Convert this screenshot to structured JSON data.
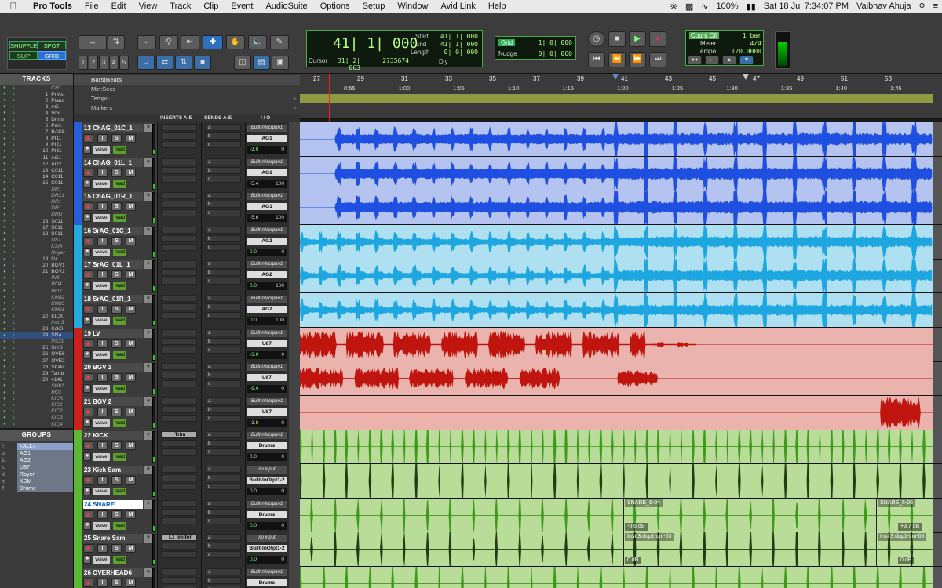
{
  "menubar": {
    "app": "Pro Tools",
    "items": [
      "File",
      "Edit",
      "View",
      "Track",
      "Clip",
      "Event",
      "AudioSuite",
      "Options",
      "Setup",
      "Window",
      "Avid Link",
      "Help"
    ],
    "battery": "100%",
    "datetime": "Sat 18 Jul  7:34:07 PM",
    "user": "Vaibhav Ahuja"
  },
  "modes": {
    "shuffle": "SHUFFLE",
    "spot": "SPOT",
    "slip": "SLIP",
    "grid": "GRID"
  },
  "zoom_presets": [
    "1",
    "2",
    "3",
    "4",
    "5"
  ],
  "counter": {
    "main": "41| 1| 000",
    "start_label": "Start",
    "end_label": "End",
    "length_label": "Length",
    "start": "41| 1| 000",
    "end": "41| 1| 000",
    "length": "0| 0| 000",
    "cursor_label": "Cursor",
    "cursor": "31| 2| 063",
    "cursor_sample": "2735674",
    "dly_label": "Dly"
  },
  "grid": {
    "grid_label": "Grid",
    "grid_value": "1| 0| 000",
    "nudge_label": "Nudge",
    "nudge_value": "0| 0| 060"
  },
  "meter_box": {
    "count_off": "Count Off",
    "meter_label": "Meter",
    "tempo_label": "Tempo",
    "bars": "1 bar",
    "meter": "4/4",
    "tempo": "120.0000"
  },
  "panels": {
    "tracks": "TRACKS",
    "groups": "GROUPS"
  },
  "track_list": [
    {
      "n": "",
      "name": "CH1",
      "ital": true
    },
    {
      "n": "1",
      "name": "PrMst"
    },
    {
      "n": "2",
      "name": "Piano"
    },
    {
      "n": "3",
      "name": "AG"
    },
    {
      "n": "4",
      "name": "Vox"
    },
    {
      "n": "5",
      "name": "Drms"
    },
    {
      "n": "6",
      "name": "Perc"
    },
    {
      "n": "7",
      "name": "BASS"
    },
    {
      "n": "8",
      "name": "PI11"
    },
    {
      "n": "9",
      "name": "PI21"
    },
    {
      "n": "10",
      "name": "PI31"
    },
    {
      "n": "11",
      "name": "AG1"
    },
    {
      "n": "12",
      "name": "AG2"
    },
    {
      "n": "13",
      "name": "C011"
    },
    {
      "n": "14",
      "name": "C011"
    },
    {
      "n": "15",
      "name": "C011"
    },
    {
      "n": "",
      "name": "DR1",
      "ital": true
    },
    {
      "n": "",
      "name": "DR21",
      "ital": true
    },
    {
      "n": "",
      "name": "DR1",
      "ital": true
    },
    {
      "n": "",
      "name": "DR1",
      "ital": true
    },
    {
      "n": "",
      "name": "DRU",
      "ital": true
    },
    {
      "n": "16",
      "name": "S011"
    },
    {
      "n": "17",
      "name": "S011"
    },
    {
      "n": "18",
      "name": "S011"
    },
    {
      "n": "",
      "name": "U87",
      "ital": true
    },
    {
      "n": "",
      "name": "KSM",
      "ital": true
    },
    {
      "n": "",
      "name": "Royer",
      "ital": true
    },
    {
      "n": "19",
      "name": "LV"
    },
    {
      "n": "20",
      "name": "BGV1"
    },
    {
      "n": "21",
      "name": "BGV2"
    },
    {
      "n": "",
      "name": "IN3",
      "ital": true
    },
    {
      "n": "",
      "name": "RO4",
      "ital": true
    },
    {
      "n": "",
      "name": "RO2",
      "ital": true
    },
    {
      "n": "",
      "name": "KM82",
      "ital": true
    },
    {
      "n": "",
      "name": "KM83",
      "ital": true
    },
    {
      "n": "",
      "name": "KM81",
      "ital": true
    },
    {
      "n": "22",
      "name": "KICK"
    },
    {
      "n": "",
      "name": "Inst 3",
      "ital": true
    },
    {
      "n": "23",
      "name": "KckS"
    },
    {
      "n": "24",
      "name": "SNA",
      "sel": true
    },
    {
      "n": "",
      "name": "Ins31",
      "ital": true
    },
    {
      "n": "25",
      "name": "SnrS"
    },
    {
      "n": "26",
      "name": "OVE6"
    },
    {
      "n": "27",
      "name": "OVE2"
    },
    {
      "n": "28",
      "name": "Shakr"
    },
    {
      "n": "29",
      "name": "Tamb"
    },
    {
      "n": "30",
      "name": "4141"
    },
    {
      "n": "",
      "name": "SH81",
      "ital": true
    },
    {
      "n": "",
      "name": "RO1",
      "ital": true
    },
    {
      "n": "",
      "name": "KICK",
      "ital": true
    },
    {
      "n": "",
      "name": "KIC1",
      "ital": true
    },
    {
      "n": "",
      "name": "KIC2",
      "ital": true
    },
    {
      "n": "",
      "name": "KIC3",
      "ital": true
    },
    {
      "n": "",
      "name": "KIC4",
      "ital": true
    }
  ],
  "groups": [
    {
      "k": "!",
      "name": "<ALL>"
    },
    {
      "k": "a",
      "name": "AG1"
    },
    {
      "k": "b",
      "name": "AG2"
    },
    {
      "k": "c",
      "name": "U87"
    },
    {
      "k": "d",
      "name": "Royer"
    },
    {
      "k": "e",
      "name": "KSM"
    },
    {
      "k": "f",
      "name": "Drumx"
    }
  ],
  "rulers": {
    "bars": "Bars|Beats",
    "min": "Min:Secs",
    "tempo": "Tempo",
    "markers": "Markers"
  },
  "bar_numbers": [
    "27",
    "29",
    "31",
    "33",
    "35",
    "37",
    "39",
    "41",
    "43",
    "45",
    "47",
    "49",
    "51",
    "53"
  ],
  "sec_numbers": [
    "0:55",
    "1:00",
    "1:05",
    "1:10",
    "1:15",
    "1:20",
    "1:25",
    "1:30",
    "1:35",
    "1:40",
    "1:45"
  ],
  "column_headers": {
    "inserts": "INSERTS A-E",
    "sends": "SENDS A-E",
    "io": "I / O"
  },
  "send_letters": [
    "a",
    "b",
    "c"
  ],
  "colors": {
    "blue": "#2a5fd4",
    "lightblue": "#27a9e0",
    "red": "#c8201a",
    "green": "#5cb832"
  },
  "tracks": [
    {
      "name": "13 ChAG_01C_1",
      "color": "#2a5fd4",
      "lane": "#b5c3f0",
      "wave": "#1f4fe0",
      "input": "Built-nMcrphn1",
      "output": "AG1",
      "vol": "-3.0",
      "pan": "0",
      "type": "ag"
    },
    {
      "name": "14 ChAG_01L_1",
      "color": "#2a5fd4",
      "lane": "#b5c3f0",
      "wave": "#1f4fe0",
      "input": "Built-nMcrphn1",
      "output": "AG1",
      "vol": "-5.4",
      "pan": "100",
      "type": "ag"
    },
    {
      "name": "15 ChAG_01R_1",
      "color": "#2a5fd4",
      "lane": "#b5c3f0",
      "wave": "#1f4fe0",
      "input": "Built-nMcrphn1",
      "output": "AG1",
      "vol": "-5.6",
      "pan": "100",
      "type": "ag"
    },
    {
      "name": "16 SrAG_01C_1",
      "color": "#27a9e0",
      "lane": "#aee0f2",
      "wave": "#1da6e0",
      "input": "Built-nMcrphn1",
      "output": "AG2",
      "vol": "0.0",
      "pan": "0",
      "type": "sr"
    },
    {
      "name": "17 SrAG_01L_1",
      "color": "#27a9e0",
      "lane": "#aee0f2",
      "wave": "#1da6e0",
      "input": "Built-nMcrphn1",
      "output": "AG2",
      "vol": "0.0",
      "pan": "100",
      "type": "sr"
    },
    {
      "name": "18 SrAG_01R_1",
      "color": "#27a9e0",
      "lane": "#aee0f2",
      "wave": "#1da6e0",
      "input": "Built-nMcrphn1",
      "output": "AG2",
      "vol": "0.0",
      "pan": "100",
      "type": "sr"
    },
    {
      "name": "19       LV",
      "color": "#c8201a",
      "lane": "#eab3ad",
      "wave": "#c0150f",
      "input": "Built-nMcrphn1",
      "output": "U87",
      "vol": "-3.0",
      "pan": "0",
      "type": "lv"
    },
    {
      "name": "20    BGV 1",
      "color": "#c8201a",
      "lane": "#eab3ad",
      "wave": "#c0150f",
      "input": "Built-nMcrphn1",
      "output": "U87",
      "vol": "-9.4",
      "pan": "0",
      "type": "bgv1"
    },
    {
      "name": "21    BGV 2",
      "color": "#c8201a",
      "lane": "#eab3ad",
      "wave": "#c0150f",
      "input": "Built-nMcrphn1",
      "output": "U87",
      "vol": "-3.8",
      "pan": "0",
      "type": "bgv2"
    },
    {
      "name": "22    KICK",
      "color": "#5cb832",
      "lane": "#b9dc98",
      "wave": "#3f9a1c",
      "input": "Built-nMcrphn1",
      "output": "Drums",
      "vol": "0.0",
      "pan": "0",
      "type": "kick",
      "insert": "Trim"
    },
    {
      "name": "23  Kick Sam",
      "color": "#5cb832",
      "lane": "#b9dc98",
      "wave": "#213d12",
      "input": "no input",
      "output": "Built-InOtpt1-2",
      "vol": "0.0",
      "pan": "0",
      "type": "kicksam"
    },
    {
      "name": "24    SNARE",
      "color": "#5cb832",
      "lane": "#b9dc98",
      "wave": "#3f9a1c",
      "input": "Built-nMcrphn1",
      "output": "Drums",
      "vol": "0.0",
      "pan": "0",
      "type": "snare",
      "sel": true,
      "clips": [
        {
          "label": "SNARE_6-04",
          "gain": "-0.6 dB"
        },
        {
          "label": "SNARE_6-06",
          "gain": "+3.7 dB"
        }
      ]
    },
    {
      "name": "25 Snare Sam",
      "color": "#5cb832",
      "lane": "#b9dc98",
      "wave": "#213d12",
      "input": "no input",
      "output": "Built-InOtpt1-2",
      "vol": "0.0",
      "pan": "0",
      "type": "snaresam",
      "insert": "L1 limiter",
      "clips": [
        {
          "label": "Inst 3.dup1-cm-03",
          "gain": "0 dB"
        },
        {
          "label": "Inst 3.dup1-cm-05",
          "gain": "0 dB"
        }
      ]
    },
    {
      "name": "26 OVERHEAD6",
      "color": "#5cb832",
      "lane": "#b9dc98",
      "wave": "#3f9a1c",
      "input": "Built-nMcrphn1",
      "output": "Drums",
      "vol": "0.0",
      "pan": "0",
      "type": "oh"
    }
  ]
}
